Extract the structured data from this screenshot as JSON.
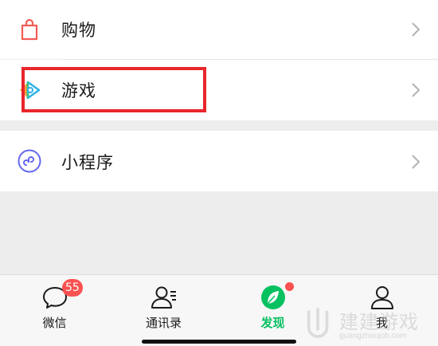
{
  "menu": {
    "items": [
      {
        "label": "购物",
        "icon": "shopping-bag-icon"
      },
      {
        "label": "游戏",
        "icon": "game-icon"
      },
      {
        "label": "小程序",
        "icon": "mini-program-icon"
      }
    ]
  },
  "tabbar": {
    "tabs": [
      {
        "label": "微信",
        "icon": "chat-bubble-icon",
        "badge": "55"
      },
      {
        "label": "通讯录",
        "icon": "contacts-icon"
      },
      {
        "label": "发现",
        "icon": "compass-icon",
        "active": true
      },
      {
        "label": "我",
        "icon": "person-icon"
      }
    ]
  },
  "watermark": {
    "text": "建建游戏",
    "url": "guangzhoujob.com"
  },
  "colors": {
    "accent": "#07c160",
    "badge": "#fa5151",
    "highlight": "#e8262c",
    "shopping": "#f25c54",
    "mini_program": "#6467f0"
  }
}
